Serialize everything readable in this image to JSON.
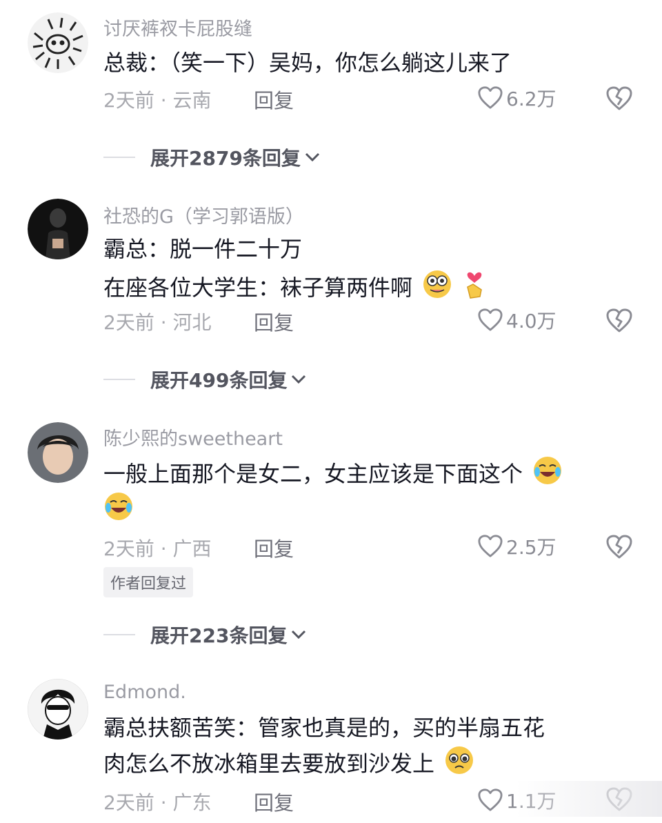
{
  "comments": [
    {
      "username": "讨厌裤衩卡屁股缝",
      "lines": [
        "总裁：（笑一下）吴妈，你怎么躺这儿来了"
      ],
      "time_location": "2天前 · 云南",
      "reply_label": "回复",
      "likes": "6.2万",
      "expand_label": "展开2879条回复"
    },
    {
      "username": "社恐的G（学习郭语版）",
      "lines": [
        "霸总：脱一件二十万",
        "在座各位大学生：袜子算两件啊"
      ],
      "time_location": "2天前 · 河北",
      "reply_label": "回复",
      "likes": "4.0万",
      "expand_label": "展开499条回复"
    },
    {
      "username": "陈少熙的sweetheart",
      "lines": [
        "一般上面那个是女二，女主应该是下面这个"
      ],
      "time_location": "2天前 · 广西",
      "reply_label": "回复",
      "likes": "2.5万",
      "author_badge": "作者回复过",
      "expand_label": "展开223条回复"
    },
    {
      "username": "Edmond.",
      "lines": [
        "霸总扶额苦笑：管家也真是的，买的半扇五花",
        "肉怎么不放冰箱里去要放到沙发上"
      ],
      "time_location": "2天前 · 广东",
      "reply_label": "回复",
      "likes": "1.1万"
    }
  ],
  "colors": {
    "text": "#161823",
    "secondary": "#9a9ba3",
    "like_icon": "#8a8b93"
  },
  "icons": [
    "heart-outline-icon",
    "broken-heart-icon",
    "chevron-down-icon"
  ]
}
